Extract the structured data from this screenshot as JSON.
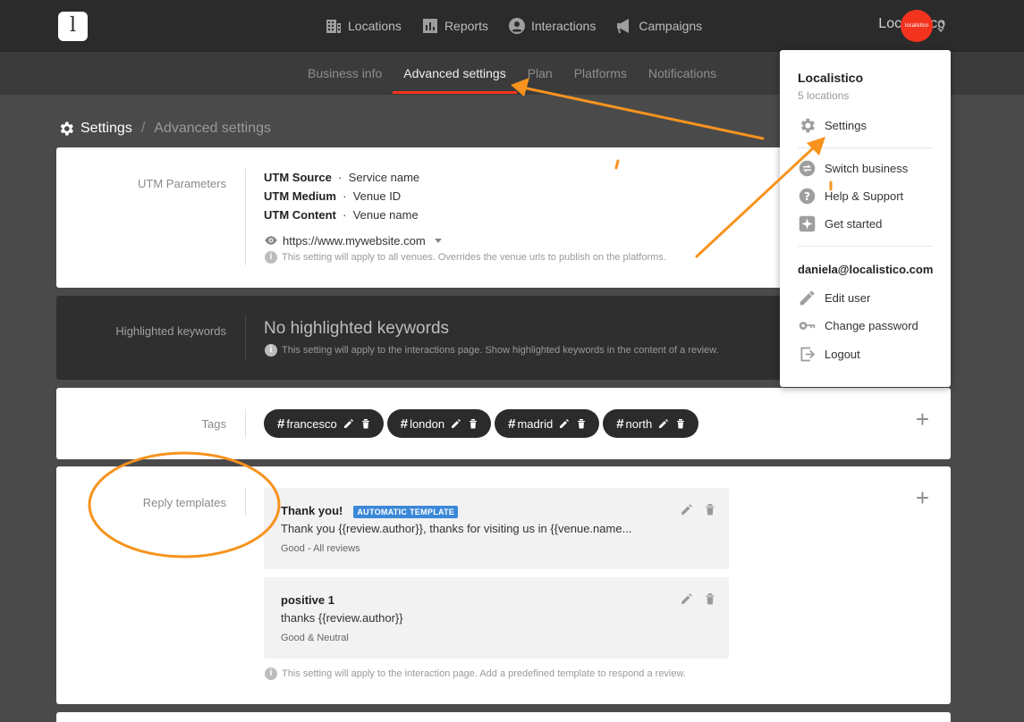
{
  "header": {
    "logo_letter": "l",
    "nav": [
      {
        "label": "Locations",
        "icon": "building-icon"
      },
      {
        "label": "Reports",
        "icon": "bar-chart-icon"
      },
      {
        "label": "Interactions",
        "icon": "user-circle-icon"
      },
      {
        "label": "Campaigns",
        "icon": "megaphone-icon"
      }
    ],
    "account_name": "Localistico",
    "avatar_text": "localistico"
  },
  "subnav": {
    "tabs": [
      "Business info",
      "Advanced settings",
      "Plan",
      "Platforms",
      "Notifications"
    ],
    "active": "Advanced settings"
  },
  "breadcrumb": {
    "root": "Settings",
    "separator": "/",
    "current": "Advanced settings"
  },
  "utm": {
    "label": "UTM Parameters",
    "rows": [
      {
        "key": "UTM Source",
        "sep": "·",
        "value": "Service name"
      },
      {
        "key": "UTM Medium",
        "sep": "·",
        "value": "Venue ID"
      },
      {
        "key": "UTM Content",
        "sep": "·",
        "value": "Venue name"
      }
    ],
    "url": "https://www.mywebsite.com",
    "info": "This setting will apply to all venues. Overrides the venue urls to publish on the platforms."
  },
  "keywords": {
    "label": "Highlighted keywords",
    "empty_text": "No highlighted keywords",
    "info": "This setting will apply to the interactions page. Show highlighted keywords in the content of a review."
  },
  "tags": {
    "label": "Tags",
    "items": [
      "francesco",
      "london",
      "madrid",
      "north"
    ],
    "hash": "#",
    "add": "+"
  },
  "templates": {
    "label": "Reply templates",
    "add": "+",
    "items": [
      {
        "title": "Thank you!",
        "badge": "AUTOMATIC TEMPLATE",
        "body": "Thank you {{review.author}}, thanks for visiting us in {{venue.name...",
        "meta": "Good - All reviews"
      },
      {
        "title": "positive 1",
        "badge": "",
        "body": "thanks {{review.author}}",
        "meta": "Good & Neutral"
      }
    ],
    "info": "This setting will apply to the interaction page. Add a predefined template to respond a review."
  },
  "dropdown": {
    "name": "Localistico",
    "sub": "5 locations",
    "items_top": [
      {
        "label": "Settings",
        "icon": "gear-icon"
      }
    ],
    "items_mid": [
      {
        "label": "Switch business",
        "icon": "switch-icon"
      },
      {
        "label": "Help & Support",
        "icon": "help-icon"
      },
      {
        "label": "Get started",
        "icon": "sparkle-icon"
      }
    ],
    "email": "daniela@localistico.com",
    "items_bottom": [
      {
        "label": "Edit user",
        "icon": "pencil-icon"
      },
      {
        "label": "Change password",
        "icon": "key-icon"
      },
      {
        "label": "Logout",
        "icon": "logout-icon"
      }
    ]
  },
  "colors": {
    "accent": "#f4331f",
    "annotation": "#f7931e",
    "badge": "#3b88d8"
  }
}
